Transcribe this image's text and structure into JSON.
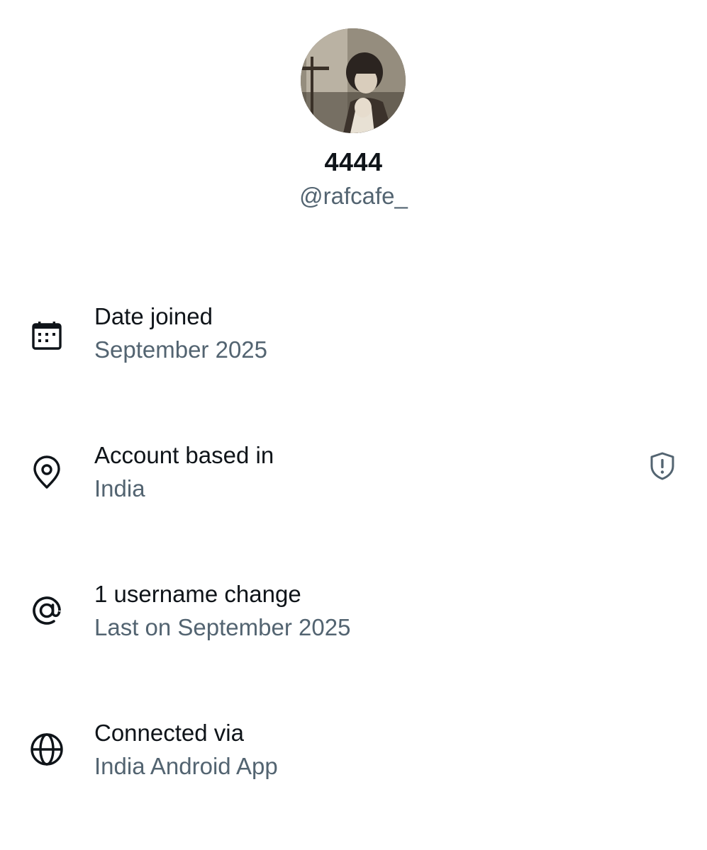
{
  "profile": {
    "display_name": "4444",
    "handle": "@rafcafe_"
  },
  "rows": [
    {
      "icon": "calendar-icon",
      "title": "Date joined",
      "value": "September 2025"
    },
    {
      "icon": "location-pin-icon",
      "title": "Account based in",
      "value": "India",
      "trailing_icon": "shield-alert-icon"
    },
    {
      "icon": "at-sign-icon",
      "title": "1 username change",
      "value": "Last on September 2025"
    },
    {
      "icon": "globe-icon",
      "title": "Connected via",
      "value": "India Android App"
    }
  ],
  "colors": {
    "primary_text": "#0f1419",
    "secondary_text": "#536471",
    "background": "#ffffff"
  }
}
